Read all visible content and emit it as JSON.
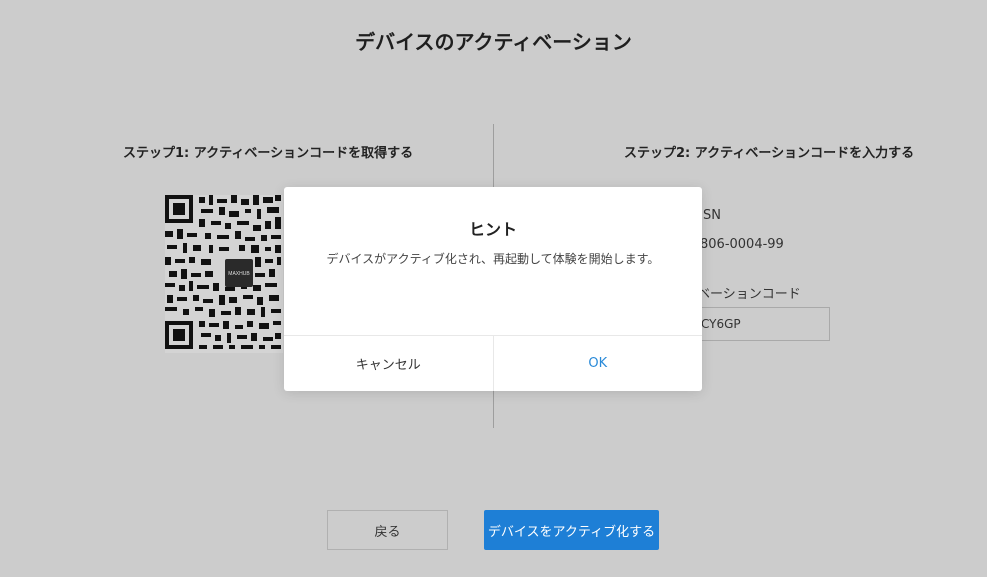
{
  "page": {
    "title": "デバイスのアクティベーション"
  },
  "step1": {
    "title": "ステップ1: アクティベーションコードを取得する",
    "qr_logo_text": "MAXHUB"
  },
  "step2": {
    "title": "ステップ2: アクティベーションコードを入力する",
    "sn_label": "SN",
    "sn_value": "806-0004-99",
    "code_label": "ベーションコード",
    "code_value": "CY6GP"
  },
  "modal": {
    "title": "ヒント",
    "message": "デバイスがアクティブ化され、再起動して体験を開始します。",
    "cancel_label": "キャンセル",
    "ok_label": "OK"
  },
  "footer": {
    "back_label": "戻る",
    "activate_label": "デバイスをアクティブ化する"
  },
  "colors": {
    "background": "#cccccc",
    "primary": "#1e7fd6",
    "link": "#2a8ad8"
  }
}
